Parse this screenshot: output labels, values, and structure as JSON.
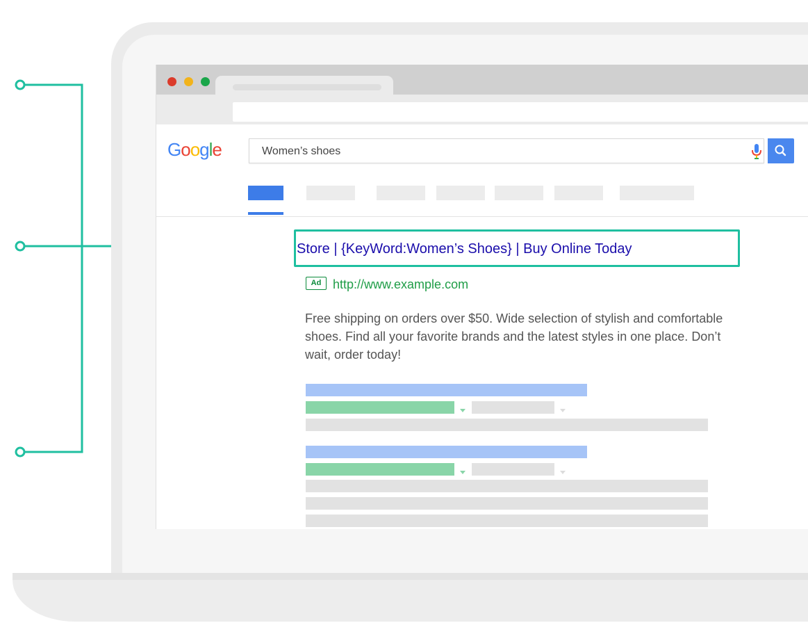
{
  "search": {
    "query": "Women’s shoes"
  },
  "logo": {
    "text": [
      "G",
      "o",
      "o",
      "g",
      "l",
      "e"
    ],
    "colors": [
      "#4285f4",
      "#ea4335",
      "#fbbc05",
      "#4285f4",
      "#34a853",
      "#ea4335"
    ]
  },
  "ad": {
    "title": "Store | {KeyWord:Women’s Shoes} | Buy Online Today",
    "badge": "Ad",
    "url": "http://www.example.com",
    "description": "Free shipping on orders over $50. Wide selection of stylish and comfortable shoes. Find all your favorite brands and the latest styles in one place. Don’t wait, order today!"
  },
  "colors": {
    "callout": "#1fbfa0",
    "link": "#1a0dab",
    "url_green": "#1f9d47",
    "google_blue": "#4a87ee",
    "window_dots": [
      "#db3b2b",
      "#f2b31b",
      "#1aa64a"
    ]
  },
  "icons": {
    "mic": "mic-icon",
    "search": "search-icon"
  }
}
